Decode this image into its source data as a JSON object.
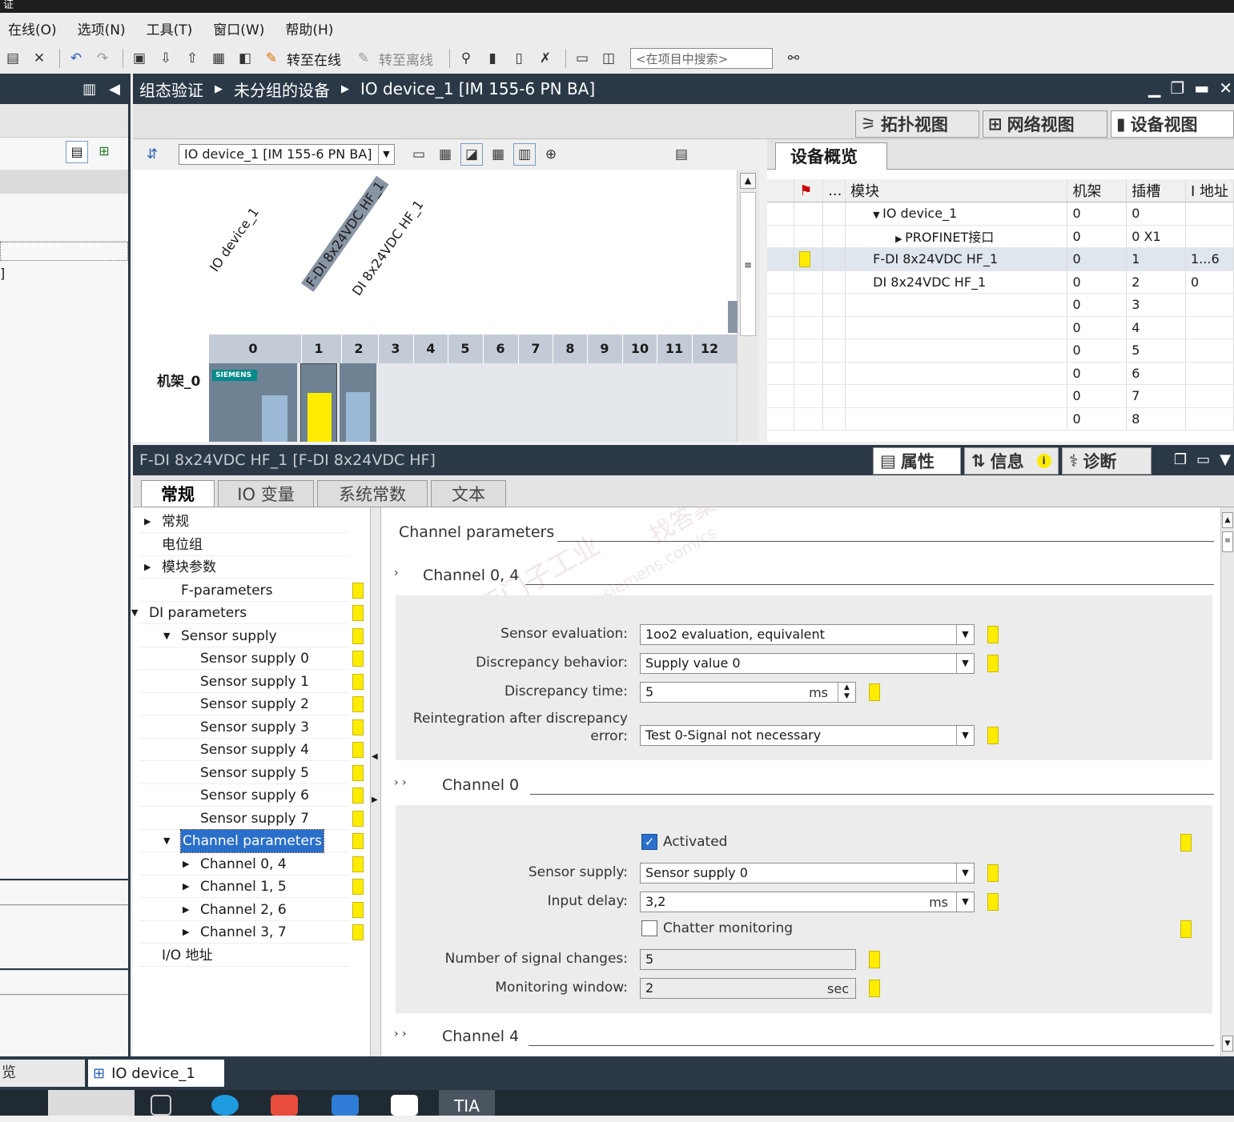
{
  "title_bar": "证",
  "menu": [
    "在线(O)",
    "选项(N)",
    "工具(T)",
    "窗口(W)",
    "帮助(H)"
  ],
  "toolbar": {
    "go_online": "转至在线",
    "go_offline": "转至离线",
    "search_placeholder": "<在项目中搜索>"
  },
  "breadcrumb": [
    "组态验证",
    "未分组的设备",
    "IO device_1 [IM 155-6 PN BA]"
  ],
  "view_tabs": {
    "topology": "拓扑视图",
    "network": "网络视图",
    "device": "设备视图"
  },
  "device_editor": {
    "device_select": "IO device_1 [IM 155-6 PN BA]",
    "module_labels": [
      "IO device_1",
      "F-DI 8x24VDC HF_1",
      "DI 8x24VDC HF_1"
    ],
    "rack_label": "机架_0",
    "slots": [
      "0",
      "1",
      "2",
      "3",
      "4",
      "5",
      "6",
      "7",
      "8",
      "9",
      "10",
      "11",
      "12"
    ],
    "brand": "SIEMENS"
  },
  "device_overview": {
    "tab": "设备概览",
    "columns": [
      "...",
      "模块",
      "机架",
      "插槽",
      "I 地址"
    ],
    "rows": [
      {
        "module": "IO device_1",
        "rack": "0",
        "slot": "0",
        "iaddr": ""
      },
      {
        "module": "PROFINET接口",
        "rack": "0",
        "slot": "0 X1",
        "iaddr": ""
      },
      {
        "module": "F-DI 8x24VDC HF_1",
        "rack": "0",
        "slot": "1",
        "iaddr": "1...6"
      },
      {
        "module": "DI 8x24VDC HF_1",
        "rack": "0",
        "slot": "2",
        "iaddr": "0"
      },
      {
        "module": "",
        "rack": "0",
        "slot": "3",
        "iaddr": ""
      },
      {
        "module": "",
        "rack": "0",
        "slot": "4",
        "iaddr": ""
      },
      {
        "module": "",
        "rack": "0",
        "slot": "5",
        "iaddr": ""
      },
      {
        "module": "",
        "rack": "0",
        "slot": "6",
        "iaddr": ""
      },
      {
        "module": "",
        "rack": "0",
        "slot": "7",
        "iaddr": ""
      },
      {
        "module": "",
        "rack": "0",
        "slot": "8",
        "iaddr": ""
      }
    ]
  },
  "inspector": {
    "title": "F-DI 8x24VDC HF_1 [F-DI 8x24VDC HF]",
    "tabs": {
      "properties": "属性",
      "info": "信息",
      "diagnostics": "诊断"
    },
    "subtabs": [
      "常规",
      "IO 变量",
      "系统常数",
      "文本"
    ]
  },
  "nav_tree": [
    {
      "label": "常规"
    },
    {
      "label": "电位组"
    },
    {
      "label": "模块参数"
    },
    {
      "label": "F-parameters"
    },
    {
      "label": "DI parameters"
    },
    {
      "label": "Sensor supply"
    },
    {
      "label": "Sensor supply 0"
    },
    {
      "label": "Sensor supply 1"
    },
    {
      "label": "Sensor supply 2"
    },
    {
      "label": "Sensor supply 3"
    },
    {
      "label": "Sensor supply 4"
    },
    {
      "label": "Sensor supply 5"
    },
    {
      "label": "Sensor supply 6"
    },
    {
      "label": "Sensor supply 7"
    },
    {
      "label": "Channel parameters"
    },
    {
      "label": "Channel 0, 4"
    },
    {
      "label": "Channel 1, 5"
    },
    {
      "label": "Channel 2, 6"
    },
    {
      "label": "Channel 3, 7"
    },
    {
      "label": "I/O 地址"
    }
  ],
  "content": {
    "section_title": "Channel parameters",
    "channel_pair": {
      "title": "Channel 0, 4",
      "sensor_evaluation_label": "Sensor evaluation:",
      "sensor_evaluation": "1oo2 evaluation, equivalent",
      "discrepancy_behavior_label": "Discrepancy behavior:",
      "discrepancy_behavior": "Supply value 0",
      "discrepancy_time_label": "Discrepancy time:",
      "discrepancy_time": "5",
      "discrepancy_time_unit": "ms",
      "reintegration_label_1": "Reintegration after discrepancy",
      "reintegration_label_2": "error:",
      "reintegration": "Test 0-Signal not necessary"
    },
    "channel0": {
      "title": "Channel 0",
      "activated_label": "Activated",
      "activated": true,
      "sensor_supply_label": "Sensor supply:",
      "sensor_supply": "Sensor supply 0",
      "input_delay_label": "Input delay:",
      "input_delay": "3,2",
      "input_delay_unit": "ms",
      "chatter_label": "Chatter monitoring",
      "chatter": false,
      "signal_changes_label": "Number of signal changes:",
      "signal_changes": "5",
      "monitoring_window_label": "Monitoring window:",
      "monitoring_window": "2",
      "monitoring_window_unit": "sec"
    },
    "channel4_title": "Channel 4"
  },
  "watermark": [
    "西门子工业",
    "找答案",
    "support.industry.siemens.com/cs"
  ],
  "bottom_bar": {
    "portal": "览",
    "device_tab": "IO device_1"
  },
  "win_taskbar": {
    "tia": "TIA"
  },
  "colors": {
    "dark_header": "#2b3947",
    "marker_yellow": "#ffec00",
    "selection": "#2a6fc9"
  }
}
